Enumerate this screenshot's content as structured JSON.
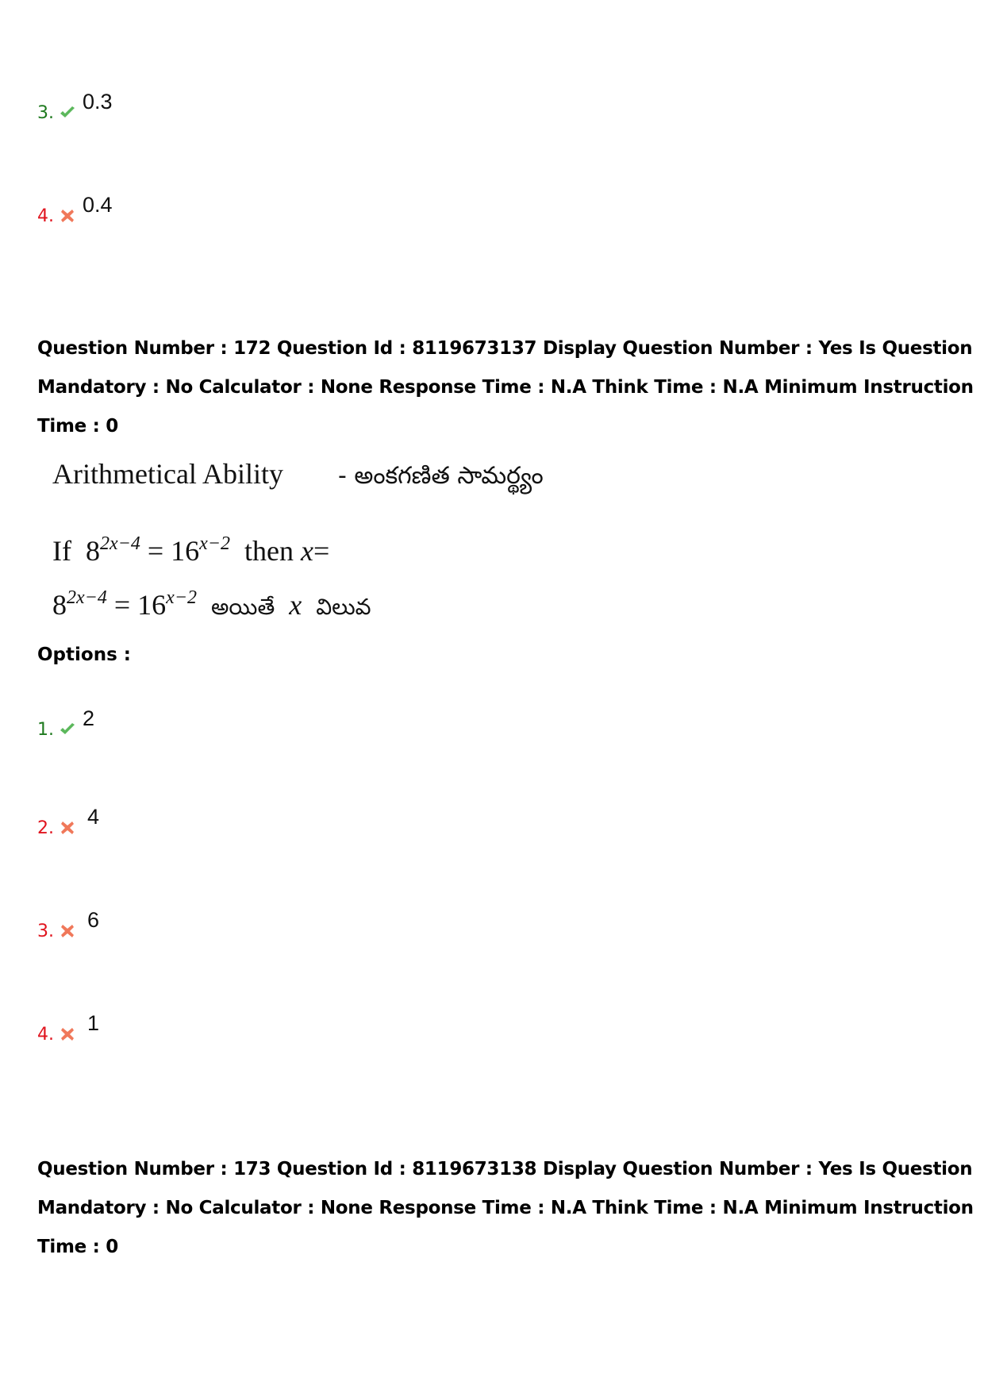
{
  "prev_question": {
    "options": [
      {
        "number": "3.",
        "status": "correct",
        "marker_icon": "check-icon",
        "value": "0.3"
      },
      {
        "number": "4.",
        "status": "wrong",
        "marker_icon": "cross-icon",
        "value": "0.4"
      }
    ]
  },
  "question_172": {
    "meta_lines": [
      "Question Number : 172 Question Id : 8119673137 Display Question Number : Yes Is Question",
      "Mandatory : No Calculator : None Response Time : N.A Think Time : N.A Minimum Instruction",
      "Time : 0"
    ],
    "section_en": "Arithmetical Ability",
    "section_te": "- అంకగణిత సామర్థ్యం",
    "eq1": {
      "prefix": "If",
      "base1": "8",
      "exp1": "2x−4",
      "equals": "=",
      "base2": "16",
      "exp2": "x−2",
      "then": "then",
      "var": "x",
      "suffix": "="
    },
    "eq2": {
      "base1": "8",
      "exp1": "2x−4",
      "equals": "=",
      "base2": "16",
      "exp2": "x−2",
      "te_if": "అయితే",
      "var": "x",
      "te_value": "విలువ"
    },
    "options_label": "Options :",
    "options": [
      {
        "number": "1.",
        "status": "correct",
        "marker_icon": "check-icon",
        "value": "2"
      },
      {
        "number": "2.",
        "status": "wrong",
        "marker_icon": "cross-icon",
        "value": "4"
      },
      {
        "number": "3.",
        "status": "wrong",
        "marker_icon": "cross-icon",
        "value": "6"
      },
      {
        "number": "4.",
        "status": "wrong",
        "marker_icon": "cross-icon",
        "value": "1"
      }
    ]
  },
  "question_173": {
    "meta_lines": [
      "Question Number : 173 Question Id : 8119673138 Display Question Number : Yes Is Question",
      "Mandatory : No Calculator : None Response Time : N.A Think Time : N.A Minimum Instruction",
      "Time : 0"
    ]
  },
  "colors": {
    "correct_number": "#1f7a1f",
    "wrong_number": "#e0141e",
    "check_marker": "#5cb85c",
    "cross_marker": "#f0785a"
  }
}
